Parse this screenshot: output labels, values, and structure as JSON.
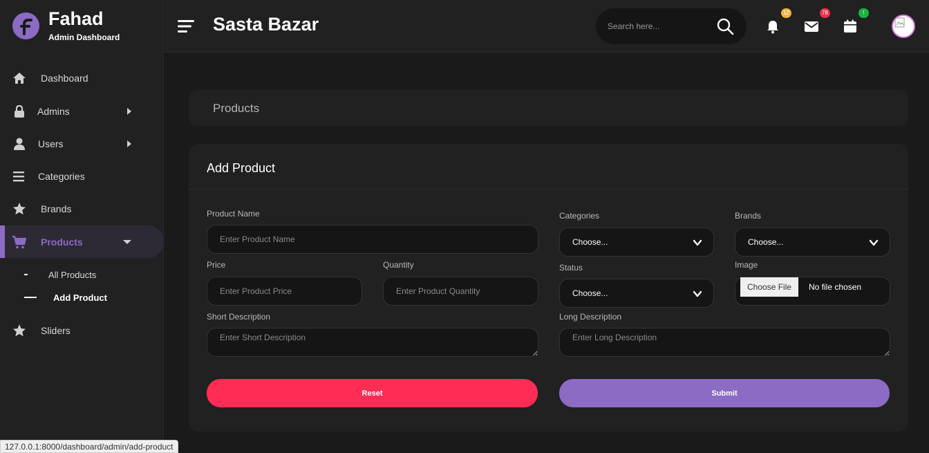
{
  "sidebar": {
    "brand_name": "Fahad",
    "brand_sub": "Admin Dashboard",
    "items": [
      {
        "label": "Dashboard"
      },
      {
        "label": "Admins"
      },
      {
        "label": "Users"
      },
      {
        "label": "Categories"
      },
      {
        "label": "Brands"
      },
      {
        "label": "Products"
      },
      {
        "label": "Sliders"
      }
    ],
    "products_sub": [
      {
        "label": "All Products"
      },
      {
        "label": "Add Product"
      }
    ]
  },
  "header": {
    "title": "Sasta Bazar",
    "search_placeholder": "Search here...",
    "badges": {
      "notifications": "12",
      "messages": "78",
      "calendar": "!"
    }
  },
  "breadcrumb": {
    "text": "Products"
  },
  "form": {
    "title": "Add Product",
    "product_name_label": "Product Name",
    "product_name_placeholder": "Enter Product Name",
    "price_label": "Price",
    "price_placeholder": "Enter Product Price",
    "quantity_label": "Quantity",
    "quantity_placeholder": "Enter Product Quantity",
    "short_desc_label": "Short Description",
    "short_desc_placeholder": "Enter Short Description",
    "categories_label": "Categories",
    "categories_value": "Choose...",
    "brands_label": "Brands",
    "brands_value": "Choose...",
    "status_label": "Status",
    "status_value": "Choose...",
    "image_label": "Image",
    "image_button": "Choose File",
    "image_status": "No file chosen",
    "long_desc_label": "Long Description",
    "long_desc_placeholder": "Enter Long Description",
    "reset_label": "Reset",
    "submit_label": "Submit"
  },
  "statusbar": {
    "url": "127.0.0.1:8000/dashboard/admin/add-product"
  },
  "colors": {
    "accent": "#8b6bc3",
    "danger": "#ff2d55",
    "badge_yellow": "#f2b441",
    "badge_red": "#e8334a",
    "badge_green": "#1fb141"
  }
}
